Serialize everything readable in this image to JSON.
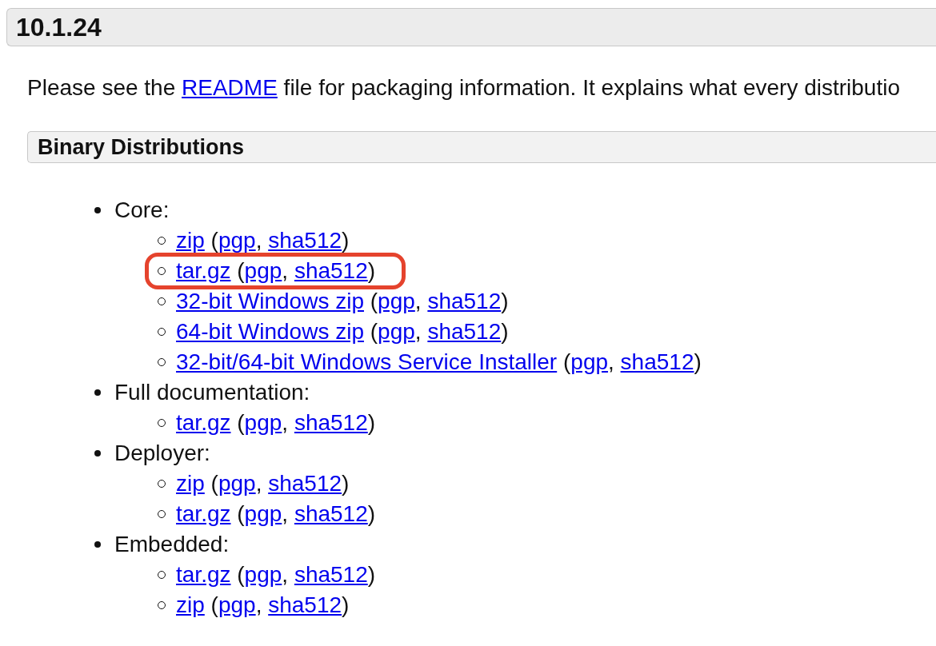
{
  "version_title": "10.1.24",
  "intro": [
    {
      "kind": "text",
      "text": "Please see the "
    },
    {
      "kind": "link",
      "text": "README"
    },
    {
      "kind": "text",
      "text": " file for packaging information. It explains what every distributio"
    }
  ],
  "section_title": "Binary Distributions",
  "groups": [
    {
      "label": "Core:",
      "items": [
        {
          "highlighted": false,
          "parts": [
            {
              "kind": "link",
              "text": "zip"
            },
            {
              "kind": "text",
              "text": " ("
            },
            {
              "kind": "link",
              "text": "pgp"
            },
            {
              "kind": "text",
              "text": ", "
            },
            {
              "kind": "link",
              "text": "sha512"
            },
            {
              "kind": "text",
              "text": ")"
            }
          ]
        },
        {
          "highlighted": true,
          "parts": [
            {
              "kind": "link",
              "text": "tar.gz"
            },
            {
              "kind": "text",
              "text": " ("
            },
            {
              "kind": "link",
              "text": "pgp"
            },
            {
              "kind": "text",
              "text": ", "
            },
            {
              "kind": "link",
              "text": "sha512"
            },
            {
              "kind": "text",
              "text": ")"
            }
          ]
        },
        {
          "highlighted": false,
          "parts": [
            {
              "kind": "link",
              "text": "32-bit Windows zip"
            },
            {
              "kind": "text",
              "text": " ("
            },
            {
              "kind": "link",
              "text": "pgp"
            },
            {
              "kind": "text",
              "text": ", "
            },
            {
              "kind": "link",
              "text": "sha512"
            },
            {
              "kind": "text",
              "text": ")"
            }
          ]
        },
        {
          "highlighted": false,
          "parts": [
            {
              "kind": "link",
              "text": "64-bit Windows zip"
            },
            {
              "kind": "text",
              "text": " ("
            },
            {
              "kind": "link",
              "text": "pgp"
            },
            {
              "kind": "text",
              "text": ", "
            },
            {
              "kind": "link",
              "text": "sha512"
            },
            {
              "kind": "text",
              "text": ")"
            }
          ]
        },
        {
          "highlighted": false,
          "parts": [
            {
              "kind": "link",
              "text": "32-bit/64-bit Windows Service Installer"
            },
            {
              "kind": "text",
              "text": " ("
            },
            {
              "kind": "link",
              "text": "pgp"
            },
            {
              "kind": "text",
              "text": ", "
            },
            {
              "kind": "link",
              "text": "sha512"
            },
            {
              "kind": "text",
              "text": ")"
            }
          ]
        }
      ]
    },
    {
      "label": "Full documentation:",
      "items": [
        {
          "highlighted": false,
          "parts": [
            {
              "kind": "link",
              "text": "tar.gz"
            },
            {
              "kind": "text",
              "text": " ("
            },
            {
              "kind": "link",
              "text": "pgp"
            },
            {
              "kind": "text",
              "text": ", "
            },
            {
              "kind": "link",
              "text": "sha512"
            },
            {
              "kind": "text",
              "text": ")"
            }
          ]
        }
      ]
    },
    {
      "label": "Deployer:",
      "items": [
        {
          "highlighted": false,
          "parts": [
            {
              "kind": "link",
              "text": "zip"
            },
            {
              "kind": "text",
              "text": " ("
            },
            {
              "kind": "link",
              "text": "pgp"
            },
            {
              "kind": "text",
              "text": ", "
            },
            {
              "kind": "link",
              "text": "sha512"
            },
            {
              "kind": "text",
              "text": ")"
            }
          ]
        },
        {
          "highlighted": false,
          "parts": [
            {
              "kind": "link",
              "text": "tar.gz"
            },
            {
              "kind": "text",
              "text": " ("
            },
            {
              "kind": "link",
              "text": "pgp"
            },
            {
              "kind": "text",
              "text": ", "
            },
            {
              "kind": "link",
              "text": "sha512"
            },
            {
              "kind": "text",
              "text": ")"
            }
          ]
        }
      ]
    },
    {
      "label": "Embedded:",
      "items": [
        {
          "highlighted": false,
          "parts": [
            {
              "kind": "link",
              "text": "tar.gz"
            },
            {
              "kind": "text",
              "text": " ("
            },
            {
              "kind": "link",
              "text": "pgp"
            },
            {
              "kind": "text",
              "text": ", "
            },
            {
              "kind": "link",
              "text": "sha512"
            },
            {
              "kind": "text",
              "text": ")"
            }
          ]
        },
        {
          "highlighted": false,
          "parts": [
            {
              "kind": "link",
              "text": "zip"
            },
            {
              "kind": "text",
              "text": " ("
            },
            {
              "kind": "link",
              "text": "pgp"
            },
            {
              "kind": "text",
              "text": ", "
            },
            {
              "kind": "link",
              "text": "sha512"
            },
            {
              "kind": "text",
              "text": ")"
            }
          ]
        }
      ]
    }
  ]
}
